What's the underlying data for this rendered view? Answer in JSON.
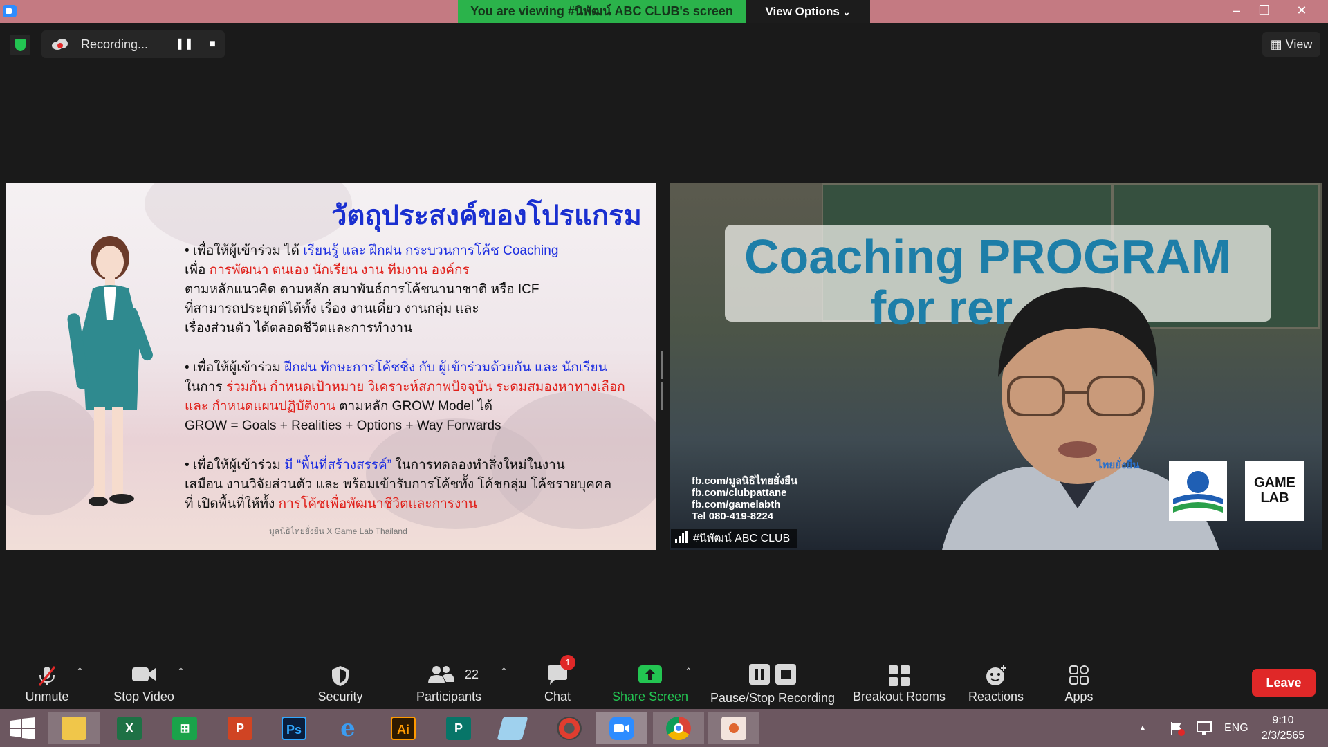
{
  "titlebar": {
    "viewing_text": "You are viewing #นิพัฒน์ ABC CLUB's screen",
    "view_options_label": "View Options",
    "minimize": "–",
    "restore": "❐",
    "close": "✕"
  },
  "recording": {
    "status_text": "Recording...",
    "pause_symbol": "❚❚",
    "stop_symbol": "■"
  },
  "view_button": {
    "label": "View"
  },
  "slide": {
    "title": "วัตถุประสงค์ของโปรแกรม",
    "p1": {
      "a": "• เพื่อให้ผู้เข้าร่วม ได้ ",
      "b": "เรียนรู้ และ ฝึกฝน กระบวนการโค้ช Coaching",
      "c": "เพื่อ ",
      "d": "การพัฒนา ตนเอง นักเรียน งาน ทีมงาน องค์กร",
      "e": "ตามหลักแนวคิด ตามหลัก สมาพันธ์การโค้ชนานาชาติ หรือ ICF",
      "f": "ที่สามารถประยุกต์ได้ทั้ง เรื่อง งานเดี่ยว งานกลุ่ม และ",
      "g": "เรื่องส่วนตัว ได้ตลอดชีวิตและการทำงาน"
    },
    "p2": {
      "a": "• เพื่อให้ผู้เข้าร่วม ",
      "b": "ฝึกฝน ทักษะการโค้ชชิ่ง กับ ผู้เข้าร่วมด้วยกัน และ นักเรียน",
      "c": "ในการ ",
      "d": "ร่วมกัน กำหนดเป้าหมาย วิเคราะห์สภาพปัจจุบัน ระดมสมองหาทางเลือก",
      "e": "และ กำหนดแผนปฏิบัติงาน",
      "f": " ตามหลัก GROW Model ได้",
      "g": "GROW = Goals + Realities + Options + Way Forwards"
    },
    "p3": {
      "a": "• เพื่อให้ผู้เข้าร่วม ",
      "b": "มี “พื้นที่สร้างสรรค์”",
      "c": " ในการทดลองทำสิ่งใหม่ในงาน",
      "d": "เสมือน งานวิจัยส่วนตัว และ พร้อมเข้ารับการโค้ชทั้ง โค้ชกลุ่ม โค้ชรายบุคคล",
      "e": "ที่ เปิดพื้นที่ให้ทั้ง ",
      "f": "การโค้ชเพื่อพัฒนาชีวิตและการงาน"
    },
    "footer": "มูลนิธิไทยยั่งยืน X Game Lab Thailand"
  },
  "video": {
    "banner_line1": "Coaching PROGRAM",
    "banner_line2": "for    rer",
    "contacts": [
      "fb.com/มูลนิธิไทยยั่งยืน",
      "fb.com/clubpattane",
      "fb.com/gamelabth",
      "Tel 080-419-8224"
    ],
    "logo1_text": "ไทยยั่งยืน",
    "logo3_line1": "GAME",
    "logo3_line2": "LAB",
    "name_tag": "#นิพัฒน์ ABC CLUB"
  },
  "toolbar": {
    "unmute": "Unmute",
    "stop_video": "Stop Video",
    "security": "Security",
    "participants": "Participants",
    "participants_count": "22",
    "chat": "Chat",
    "chat_badge": "1",
    "share_screen": "Share Screen",
    "pause_stop_recording": "Pause/Stop Recording",
    "breakout_rooms": "Breakout Rooms",
    "reactions": "Reactions",
    "apps": "Apps",
    "leave": "Leave",
    "caret": "⌃"
  },
  "taskbar": {
    "apps": [
      {
        "icon": "windows-start-icon",
        "text": ""
      },
      {
        "icon": "file-explorer-icon",
        "text": ""
      },
      {
        "icon": "excel-icon",
        "text": "X"
      },
      {
        "icon": "store-icon",
        "text": "⊞"
      },
      {
        "icon": "powerpoint-icon",
        "text": "P"
      },
      {
        "icon": "photoshop-icon",
        "text": "Ps"
      },
      {
        "icon": "internet-explorer-icon",
        "text": "e"
      },
      {
        "icon": "illustrator-icon",
        "text": "Ai"
      },
      {
        "icon": "publisher-icon",
        "text": "P"
      },
      {
        "icon": "notepad-icon",
        "text": ""
      },
      {
        "icon": "photoscape-icon",
        "text": ""
      },
      {
        "icon": "zoom-icon",
        "text": ""
      },
      {
        "icon": "chrome-icon",
        "text": ""
      },
      {
        "icon": "image-viewer-icon",
        "text": ""
      }
    ],
    "tray_arrow": "▲",
    "language": "ENG",
    "time": "9:10",
    "date": "2/3/2565"
  },
  "colors": {
    "titlebar": "#c47a82",
    "viewing_banner": "#2bb34b",
    "leave": "#e02828",
    "share_screen": "#23c552",
    "taskbar": "#6c5760"
  }
}
